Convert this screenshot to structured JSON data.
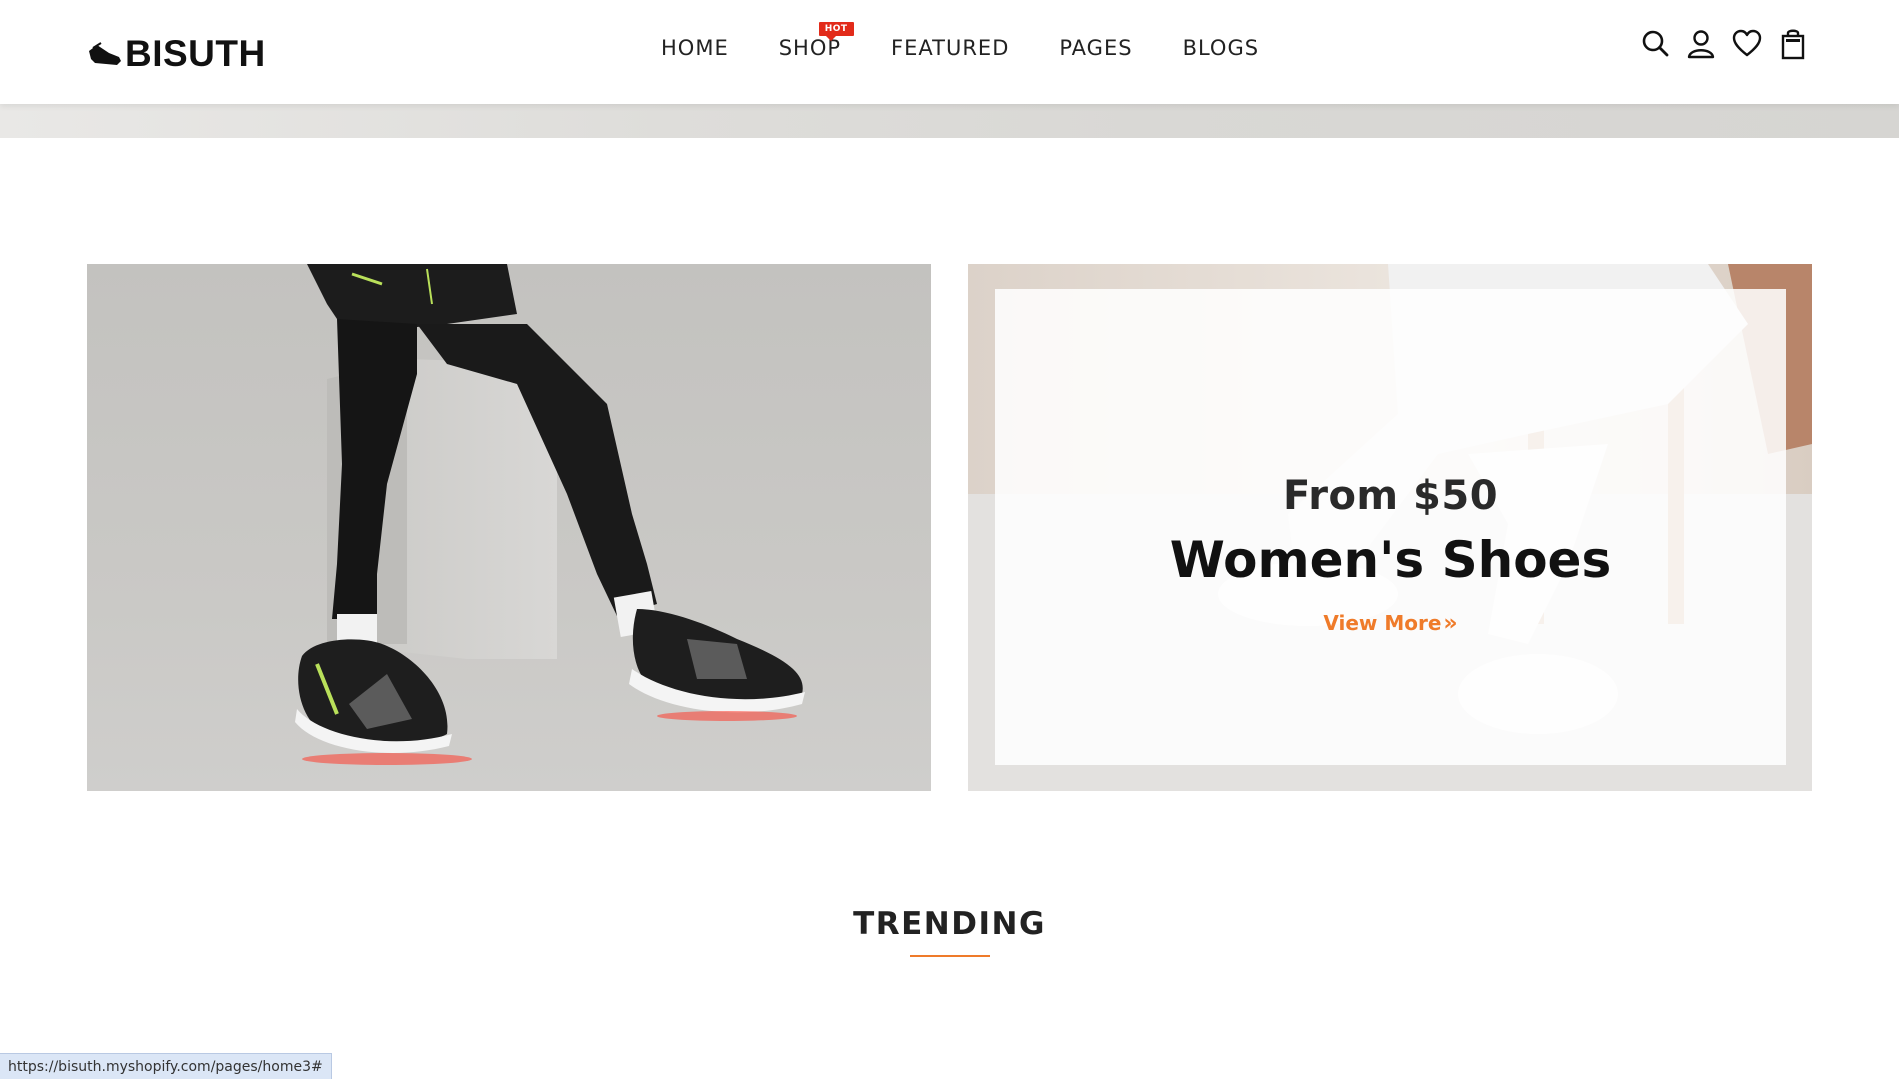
{
  "brand": {
    "name": "BISUTH"
  },
  "nav": {
    "items": [
      {
        "label": "HOME"
      },
      {
        "label": "SHOP",
        "badge": "HOT"
      },
      {
        "label": "FEATURED"
      },
      {
        "label": "PAGES"
      },
      {
        "label": "BLOGS"
      }
    ]
  },
  "header_icons": [
    "search-icon",
    "account-icon",
    "wishlist-heart-icon",
    "cart-bag-icon"
  ],
  "banner_right": {
    "price_text": "From $50",
    "title": "Women's Shoes",
    "link_label": "View More",
    "link_arrow": "»"
  },
  "trending": {
    "title": "TRENDING"
  },
  "status_bar": {
    "url": "https://bisuth.myshopify.com/pages/home3#"
  },
  "colors": {
    "accent": "#ef7b2a",
    "hot_badge": "#e22b1a"
  }
}
